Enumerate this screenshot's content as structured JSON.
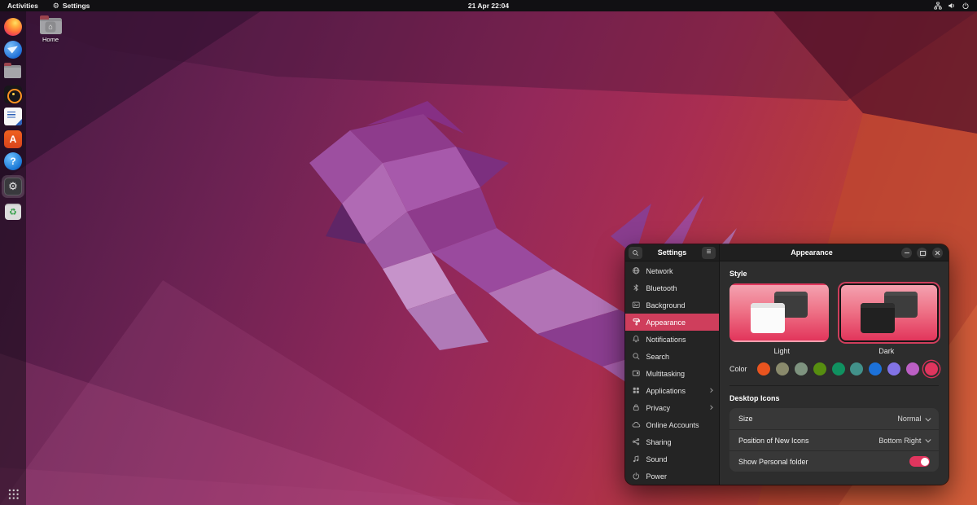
{
  "colors": {
    "accent": "#cf3e5c",
    "toggle_on": "#e0355e",
    "swatch_ring": "#d83158"
  },
  "topbar": {
    "activities_label": "Activities",
    "app_menu_label": "Settings",
    "clock": "21 Apr 22:04",
    "tray_icons": [
      "network-icon",
      "volume-icon",
      "power-icon"
    ]
  },
  "desktop": {
    "home_label": "Home"
  },
  "dock": {
    "items": [
      {
        "name": "firefox"
      },
      {
        "name": "thunderbird"
      },
      {
        "name": "files"
      },
      {
        "name": "rhythmbox"
      },
      {
        "name": "libreoffice-writer"
      },
      {
        "name": "ubuntu-software"
      },
      {
        "name": "help"
      },
      {
        "name": "settings",
        "active": true
      },
      {
        "name": "trash"
      }
    ],
    "show_apps": "show-applications"
  },
  "window": {
    "sidebar_title": "Settings",
    "content_title": "Appearance",
    "sidebar_items": [
      {
        "label": "Network",
        "icon": "network-icon"
      },
      {
        "label": "Bluetooth",
        "icon": "bluetooth-icon"
      },
      {
        "label": "Background",
        "icon": "background-icon"
      },
      {
        "label": "Appearance",
        "icon": "appearance-icon",
        "selected": true
      },
      {
        "label": "Notifications",
        "icon": "notifications-icon"
      },
      {
        "label": "Search",
        "icon": "search-icon"
      },
      {
        "label": "Multitasking",
        "icon": "multitasking-icon"
      },
      {
        "label": "Applications",
        "icon": "applications-icon",
        "chevron": true
      },
      {
        "label": "Privacy",
        "icon": "privacy-icon",
        "chevron": true
      },
      {
        "label": "Online Accounts",
        "icon": "online-accounts-icon"
      },
      {
        "label": "Sharing",
        "icon": "sharing-icon"
      },
      {
        "label": "Sound",
        "icon": "sound-icon"
      },
      {
        "label": "Power",
        "icon": "power-icon"
      }
    ],
    "style_section": {
      "heading": "Style",
      "options": [
        {
          "label": "Light",
          "selected": false
        },
        {
          "label": "Dark",
          "selected": true
        }
      ]
    },
    "color_row": {
      "label": "Color",
      "swatches": [
        {
          "name": "orange",
          "hex": "#E9541F"
        },
        {
          "name": "bark",
          "hex": "#8A8A6C"
        },
        {
          "name": "sage",
          "hex": "#7E937F"
        },
        {
          "name": "olive",
          "hex": "#578E10"
        },
        {
          "name": "viridian",
          "hex": "#109160"
        },
        {
          "name": "prussian-green",
          "hex": "#42918A"
        },
        {
          "name": "blue",
          "hex": "#1C71D8"
        },
        {
          "name": "purple",
          "hex": "#8273E6"
        },
        {
          "name": "magenta",
          "hex": "#BB5FC4"
        },
        {
          "name": "red",
          "hex": "#E0355E",
          "selected": true
        }
      ]
    },
    "desktop_icons_section": {
      "heading": "Desktop Icons",
      "rows": [
        {
          "label": "Size",
          "value": "Normal",
          "control": "dropdown"
        },
        {
          "label": "Position of New Icons",
          "value": "Bottom Right",
          "control": "dropdown"
        },
        {
          "label": "Show Personal folder",
          "control": "toggle",
          "state": "on"
        }
      ]
    }
  }
}
